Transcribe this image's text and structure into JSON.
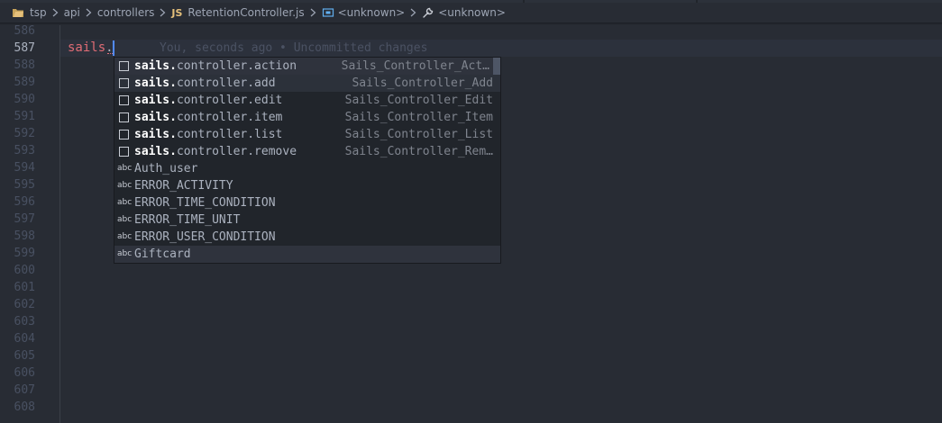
{
  "breadcrumb": {
    "items": [
      {
        "label": "tsp",
        "icon": "folder-icon"
      },
      {
        "label": "api"
      },
      {
        "label": "controllers"
      },
      {
        "label": "RetentionController.js",
        "badge": "JS"
      },
      {
        "label": "<unknown>",
        "icon": "symbol-icon"
      },
      {
        "label": "<unknown>",
        "icon": "wrench-icon"
      }
    ]
  },
  "editor": {
    "line_numbers": [
      "586",
      "587",
      "588",
      "589",
      "590",
      "591",
      "592",
      "593",
      "594",
      "595",
      "596",
      "597",
      "598",
      "599",
      "600",
      "601",
      "602",
      "603",
      "604",
      "605",
      "606",
      "607",
      "608"
    ],
    "active_line": "587",
    "code_ident": "sails",
    "code_dot": ".",
    "blame": "You, seconds ago • Uncommitted changes"
  },
  "suggestions": [
    {
      "kind": "box",
      "match": "sails.",
      "rest": "controller.action",
      "detail": "Sails_Controller_Act…"
    },
    {
      "kind": "box",
      "match": "sails.",
      "rest": "controller.add",
      "detail": "Sails_Controller_Add"
    },
    {
      "kind": "box",
      "match": "sails.",
      "rest": "controller.edit",
      "detail": "Sails_Controller_Edit"
    },
    {
      "kind": "box",
      "match": "sails.",
      "rest": "controller.item",
      "detail": "Sails_Controller_Item"
    },
    {
      "kind": "box",
      "match": "sails.",
      "rest": "controller.list",
      "detail": "Sails_Controller_List"
    },
    {
      "kind": "box",
      "match": "sails.",
      "rest": "controller.remove",
      "detail": "Sails_Controller_Rem…"
    },
    {
      "kind": "abc",
      "match": "",
      "rest": "Auth_user",
      "detail": ""
    },
    {
      "kind": "abc",
      "match": "",
      "rest": "ERROR_ACTIVITY",
      "detail": ""
    },
    {
      "kind": "abc",
      "match": "",
      "rest": "ERROR_TIME_CONDITION",
      "detail": ""
    },
    {
      "kind": "abc",
      "match": "",
      "rest": "ERROR_TIME_UNIT",
      "detail": ""
    },
    {
      "kind": "abc",
      "match": "",
      "rest": "ERROR_USER_CONDITION",
      "detail": ""
    },
    {
      "kind": "abc",
      "match": "",
      "rest": "Giftcard",
      "detail": ""
    }
  ],
  "abc_icon_text": "abc",
  "colors": {
    "background": "#282c34",
    "identifier": "#e06c75",
    "cursor": "#528bff",
    "js_badge": "#e5c07b"
  }
}
